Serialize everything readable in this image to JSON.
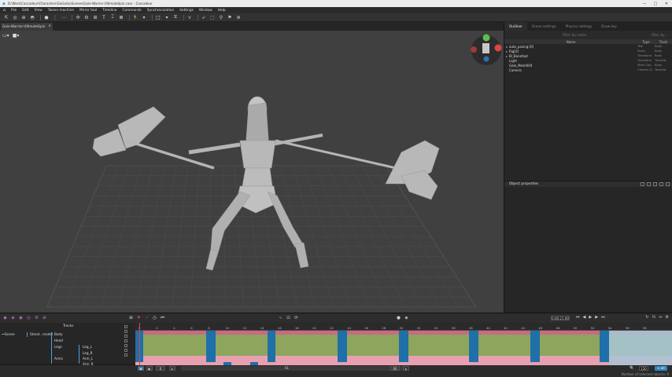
{
  "window": {
    "title": "D:\\Work\\Cascadeur\\Characters\\GoGoGo\\Scenes\\Gale-Warrior-UltimateSpin.casc - Cascadeur",
    "controls": [
      "—",
      "□",
      "✕"
    ]
  },
  "menu": [
    "File",
    "Edit",
    "View",
    "Tween machine",
    "Mirror tool",
    "Timeline",
    "Commands",
    "Synchronization",
    "Settings",
    "Window",
    "Help"
  ],
  "doc_tab": {
    "label": "Gale-Warrior-UltimateSpin",
    "close": "×"
  },
  "right_panel": {
    "tabs": [
      "Outliner",
      "Scene settings",
      "Physics settings",
      "Draw key"
    ],
    "filter_placeholder": "Filter by name",
    "filter_type": "Filter by...",
    "columns": [
      "Name",
      "Type",
      "Track"
    ],
    "rows": [
      {
        "name": "auto_posing:[0]",
        "type": "Tool",
        "track": "Body",
        "arrow": "▸"
      },
      {
        "name": "Rig[0]",
        "type": "Rools",
        "track": "Body",
        "arrow": "▸"
      },
      {
        "name": "Bl_Bonefoot",
        "type": "Transform",
        "track": "Body",
        "arrow": "▸"
      },
      {
        "name": "Light",
        "type": "Transform",
        "track": "Tracklist",
        "arrow": ""
      },
      {
        "name": "Gale_Mesh004",
        "type": "Mesh Obj...",
        "track": "Body",
        "arrow": ""
      },
      {
        "name": "Camera",
        "type": "Camera (t...",
        "track": "Tracklist",
        "arrow": ""
      }
    ],
    "object_properties": "Object properties"
  },
  "timeline": {
    "timecode": "0:00:21:00",
    "tracks_header": "Tracks",
    "track_names": [
      "Scene",
      "Stand...model",
      "Body",
      "Head",
      "Legs",
      "Leg_L",
      "Leg_R",
      "Arms",
      "Arm_L",
      "Arm_R"
    ],
    "ruler": [
      "0",
      "2",
      "4",
      "6",
      "8",
      "10",
      "12",
      "14",
      "16",
      "18",
      "20",
      "22",
      "24",
      "26",
      "28",
      "30",
      "32",
      "34",
      "36",
      "38",
      "40",
      "42",
      "44",
      "46",
      "48",
      "50",
      "52",
      "54",
      "56",
      "58"
    ],
    "range_start": "0",
    "range_mid": "61",
    "range_end": "60",
    "zoom": "120",
    "all_label": "≡ all",
    "status": "Number of selected objects: 0"
  },
  "colors": {
    "viewport_bg": "#404040",
    "green_lane": "#8da55d",
    "pink_lane": "#e8a0b0",
    "key_blue": "#1f6fa8",
    "accent": "#2e86c1"
  }
}
